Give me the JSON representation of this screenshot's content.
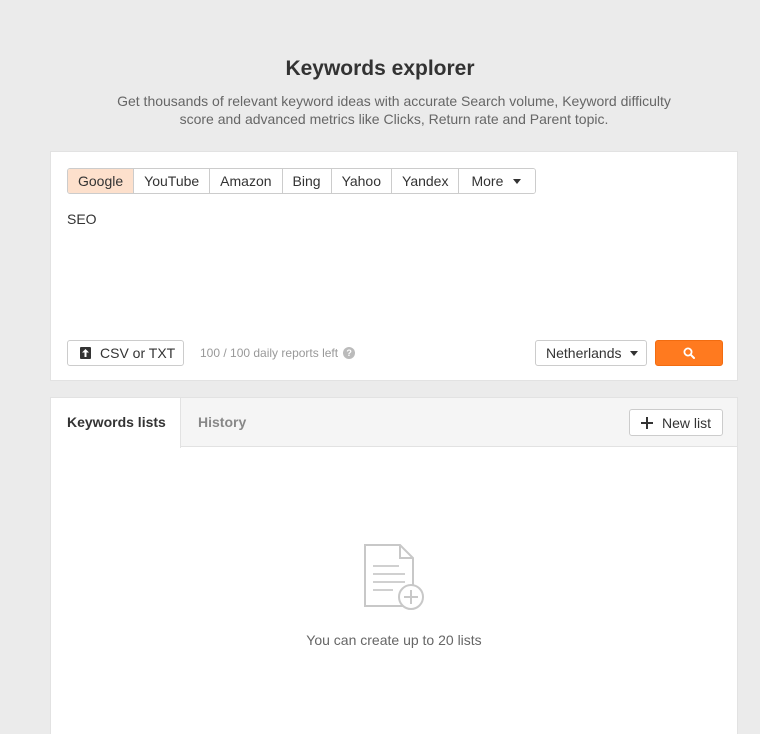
{
  "header": {
    "title": "Keywords explorer",
    "subtitle": "Get thousands of relevant keyword ideas with accurate Search volume, Keyword difficulty score and advanced metrics like Clicks, Return rate and Parent topic."
  },
  "search": {
    "engines": [
      "Google",
      "YouTube",
      "Amazon",
      "Bing",
      "Yahoo",
      "Yandex"
    ],
    "active_engine": "Google",
    "more_label": "More",
    "query": "SEO",
    "upload_label": "CSV or TXT",
    "reports_left": "100 / 100 daily reports left",
    "country": "Netherlands"
  },
  "lists": {
    "tabs": [
      "Keywords lists",
      "History"
    ],
    "active_tab": "Keywords lists",
    "new_list_label": "New list",
    "empty_message": "You can create up to 20 lists"
  },
  "colors": {
    "accent": "#ff7a1f",
    "active_engine_bg": "#fde0cc",
    "background": "#ebebeb"
  },
  "icons": {
    "upload": "upload-icon",
    "help": "help-icon",
    "caret": "caret-down-icon",
    "search": "search-icon",
    "plus": "plus-icon",
    "empty": "document-add-icon"
  }
}
